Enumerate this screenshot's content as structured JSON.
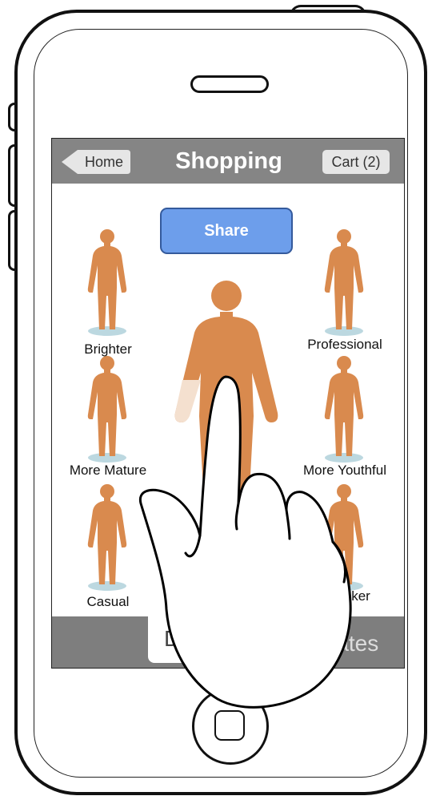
{
  "navbar": {
    "back_label": "Home",
    "title": "Shopping",
    "cart_label": "Cart (2)"
  },
  "share_button": {
    "label": "Share"
  },
  "figures": {
    "brighter": "Brighter",
    "professional": "Professional",
    "more_mature": "More Mature",
    "more_youthful": "More Youthful",
    "casual": "Casual",
    "darker_partial": "ker"
  },
  "tabbar": {
    "left_partial": "D",
    "right_partial": "rates"
  },
  "colors": {
    "figure": "#d98a4e",
    "navbar": "#858585",
    "share_fill": "#6d9eeb",
    "share_border": "#345a9c",
    "tabbar": "#7e7e7e"
  }
}
